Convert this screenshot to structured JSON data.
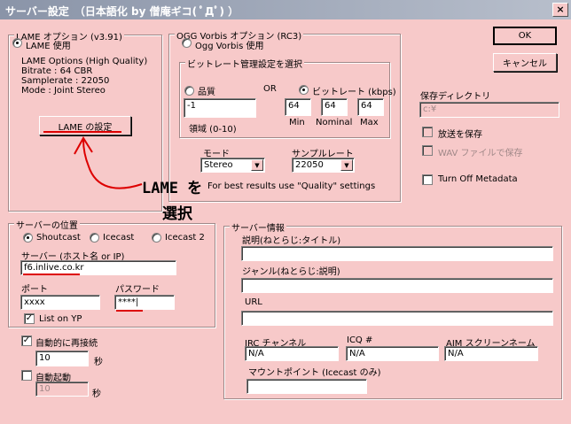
{
  "window": {
    "title": "サーバー設定　（日本語化 by 僧庵ギコ( ﾟДﾟ) ）",
    "close_glyph": "×"
  },
  "buttons": {
    "ok": "OK",
    "cancel": "キャンセル"
  },
  "lame": {
    "group_title": "LAME オプション (v3.91)",
    "use_label": "LAME 使用",
    "options_lines": [
      "LAME Options (High Quality)",
      "Bitrate : 64 CBR",
      "Samplerate : 22050",
      "Mode : Joint Stereo"
    ],
    "settings_button": "LAME の設定"
  },
  "ogg": {
    "group_title": "OGG Vorbis オプション (RC3)",
    "use_label": "Ogg Vorbis 使用",
    "bitrate_group_title": "ビットレート管理設定を選択",
    "quality_label": "品質",
    "or_label": "OR",
    "bitrate_label": "ビットレート (kbps)",
    "quality_value": "-1",
    "quality_range": "領域 (0-10)",
    "min_value": "64",
    "nominal_value": "64",
    "max_value": "64",
    "min_label": "Min",
    "nominal_label": "Nominal",
    "max_label": "Max",
    "mode_label": "モード",
    "mode_value": "Stereo",
    "samplerate_label": "サンプルレート",
    "samplerate_value": "22050",
    "hint": "For best results use \"Quality\" settings"
  },
  "save": {
    "dir_label": "保存ディレクトリ",
    "dir_value": "c:¥",
    "broadcast_save": "放送を保存",
    "wav_save": "WAV ファイルで保存",
    "turn_off_metadata": "Turn Off Metadata"
  },
  "server_location": {
    "group_title": "サーバーの位置",
    "shoutcast": "Shoutcast",
    "icecast": "Icecast",
    "icecast2": "Icecast 2",
    "server_label": "サーバー (ホスト名 or IP)",
    "server_value": "f6.inlive.co.kr",
    "port_label": "ポート",
    "port_value": "xxxx",
    "password_label": "パスワード",
    "password_value": "****|",
    "list_on_yp": "List on YP"
  },
  "reconnect": {
    "auto_reconnect": "自動的に再接続",
    "reconnect_value": "10",
    "seconds": "秒",
    "auto_start": "自動起動",
    "start_value": "10",
    "seconds2": "秒"
  },
  "server_info": {
    "group_title": "サーバー情報",
    "description_label": "説明(ねとらじ:タイトル)",
    "description_value": "",
    "genre_label": "ジャンル(ねとらじ:説明)",
    "genre_value": "",
    "url_label": "URL",
    "url_value": "",
    "irc_label": "IRC チャンネル",
    "irc_value": "N/A",
    "icq_label": "ICQ #",
    "icq_value": "N/A",
    "aim_label": "AIM スクリーンネーム",
    "aim_value": "N/A",
    "mount_label": "マウントポイント (Icecast のみ)",
    "mount_value": ""
  },
  "annotation": {
    "line1": "LAME を",
    "line2": "選択"
  }
}
